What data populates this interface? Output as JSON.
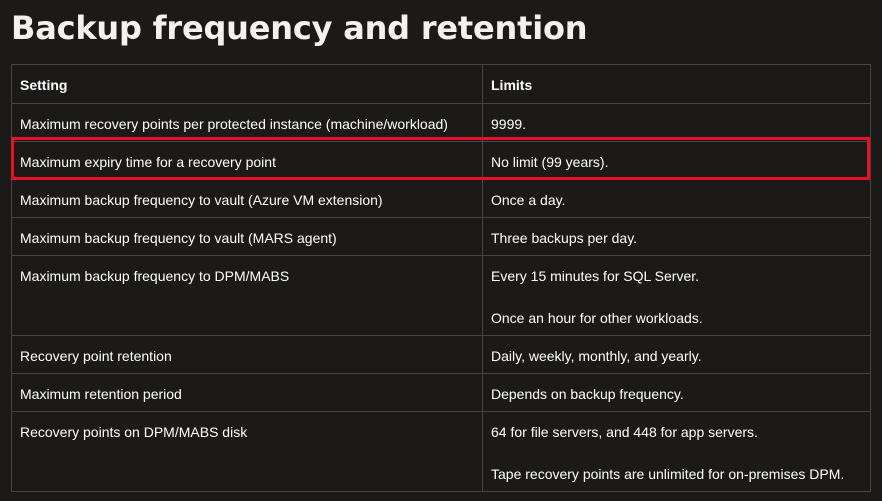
{
  "page": {
    "title": "Backup frequency and retention"
  },
  "table": {
    "headers": [
      "Setting",
      "Limits"
    ],
    "rows": [
      {
        "setting": "Maximum recovery points per protected instance (machine/workload)",
        "limits": [
          "9999."
        ]
      },
      {
        "setting": "Maximum expiry time for a recovery point",
        "limits": [
          "No limit (99 years)."
        ],
        "highlighted": true
      },
      {
        "setting": "Maximum backup frequency to vault (Azure VM extension)",
        "limits": [
          "Once a day."
        ]
      },
      {
        "setting": "Maximum backup frequency to vault (MARS agent)",
        "limits": [
          "Three backups per day."
        ]
      },
      {
        "setting": "Maximum backup frequency to DPM/MABS",
        "limits": [
          "Every 15 minutes for SQL Server.",
          "Once an hour for other workloads."
        ]
      },
      {
        "setting": "Recovery point retention",
        "limits": [
          "Daily, weekly, monthly, and yearly."
        ]
      },
      {
        "setting": "Maximum retention period",
        "limits": [
          "Depends on backup frequency."
        ]
      },
      {
        "setting": "Recovery points on DPM/MABS disk",
        "limits": [
          "64 for file servers, and 448 for app servers.",
          "Tape recovery points are unlimited for on-premises DPM."
        ]
      }
    ]
  },
  "colors": {
    "background": "#1b1a19",
    "text": "#ffffff",
    "border": "#464646",
    "highlight": "#e81123"
  }
}
